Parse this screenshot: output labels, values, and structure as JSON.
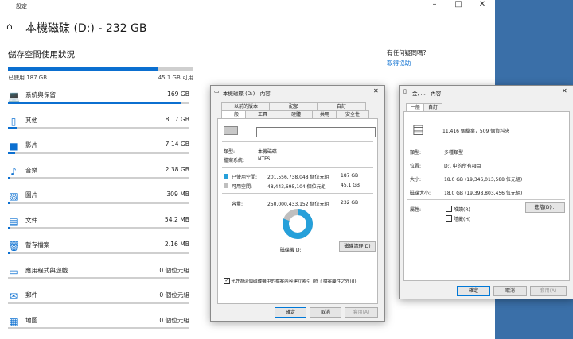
{
  "settings": {
    "title": "設定",
    "page_title": "本機磁碟 (D:) - 232 GB",
    "section_title": "儲存空間使用狀況",
    "used_label": "已使用 187 GB",
    "free_label": "45.1 GB 可用",
    "used_fraction": 0.81,
    "help_title": "有任何疑問嗎?",
    "help_link": "取得協助",
    "categories": [
      {
        "icon": "laptop-icon",
        "glyph": "💻",
        "label": "系統與保留",
        "value": "169 GB",
        "fraction": 0.95
      },
      {
        "icon": "folder-icon",
        "glyph": "▯",
        "label": "其他",
        "value": "8.17 GB",
        "fraction": 0.05
      },
      {
        "icon": "video-icon",
        "glyph": "■",
        "label": "影片",
        "value": "7.14 GB",
        "fraction": 0.04
      },
      {
        "icon": "music-icon",
        "glyph": "♪",
        "label": "音樂",
        "value": "2.38 GB",
        "fraction": 0.015
      },
      {
        "icon": "picture-icon",
        "glyph": "▨",
        "label": "圖片",
        "value": "309 MB",
        "fraction": 0.005
      },
      {
        "icon": "document-icon",
        "glyph": "▤",
        "label": "文件",
        "value": "54.2 MB",
        "fraction": 0.003
      },
      {
        "icon": "trash-icon",
        "glyph": "🗑",
        "label": "暫存檔案",
        "value": "2.16 MB",
        "fraction": 0.002
      },
      {
        "icon": "apps-icon",
        "glyph": "▭",
        "label": "應用程式與遊戲",
        "value": "0 個位元組",
        "fraction": 0
      },
      {
        "icon": "mail-icon",
        "glyph": "✉",
        "label": "郵件",
        "value": "0 個位元組",
        "fraction": 0
      },
      {
        "icon": "map-icon",
        "glyph": "▦",
        "label": "地圖",
        "value": "0 個位元組",
        "fraction": 0
      }
    ]
  },
  "disk_dialog": {
    "title": "本機磁碟 (D:) - 內容",
    "tabs_row1": [
      "以前的版本",
      "配額",
      "自訂"
    ],
    "tabs_row2": [
      "一般",
      "工具",
      "硬體",
      "共用",
      "安全性"
    ],
    "type_label": "類型:",
    "type_value": "本機磁碟",
    "fs_label": "檔案系統:",
    "fs_value": "NTFS",
    "used_label": "已使用空間:",
    "used_bytes": "201,556,738,048 個位元組",
    "used_gb": "187 GB",
    "free_label": "可用空間:",
    "free_bytes": "48,443,695,104 個位元組",
    "free_gb": "45.1 GB",
    "capacity_label": "容量:",
    "capacity_bytes": "250,000,433,152 個位元組",
    "capacity_gb": "232 GB",
    "drive_label": "磁碟機 D:",
    "cleanup_button": "磁碟清理(D)",
    "index_checkbox": "允許為這個磁碟機中的檔案內容建立索引 (除了檔案屬性之外)(I)",
    "ok": "確定",
    "cancel": "取消",
    "apply": "套用(A)",
    "used_color": "#26a0da",
    "free_color": "#bfbfbf",
    "used_fraction": 0.806
  },
  "multi_dialog": {
    "title": "金, ... - 內容",
    "tabs": [
      "一般",
      "自訂"
    ],
    "summary": "11,416 個檔案，509 個資料夾",
    "type_label": "類型:",
    "type_value": "多種類型",
    "location_label": "位置:",
    "location_value": "D:\\ 中的所有項目",
    "size_label": "大小:",
    "size_value": "18.0 GB (19,346,013,588 位元組)",
    "disk_size_label": "磁碟大小:",
    "disk_size_value": "18.0 GB (19,398,803,456 位元組)",
    "attr_label": "屬性:",
    "readonly": "唯讀(R)",
    "hidden": "隱藏(H)",
    "advanced_button": "進階(D)...",
    "ok": "確定",
    "cancel": "取消",
    "apply": "套用(A)"
  }
}
